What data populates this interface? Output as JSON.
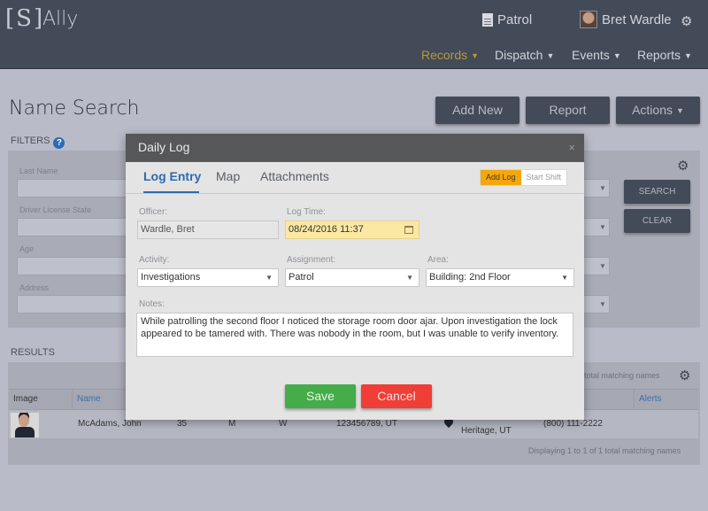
{
  "app": {
    "logo": "[S]",
    "name": "Ally"
  },
  "header": {
    "shift_label": "Patrol",
    "shift_icon": "document-icon",
    "user_name": "Bret Wardle",
    "settings_icon": "gear-icon"
  },
  "nav": [
    {
      "label": "Records",
      "active": true
    },
    {
      "label": "Dispatch",
      "active": false
    },
    {
      "label": "Events",
      "active": false
    },
    {
      "label": "Reports",
      "active": false
    }
  ],
  "page": {
    "title": "Name Search",
    "buttons": {
      "add_new": "Add New",
      "report": "Report",
      "actions": "Actions"
    }
  },
  "filters": {
    "label": "FILTERS",
    "fields": [
      {
        "label": "Last Name",
        "value": ""
      },
      {
        "label": "Driver License State",
        "value": ""
      },
      {
        "label": "Age",
        "value": ""
      },
      {
        "label": "Address",
        "value": ""
      }
    ],
    "search_label": "SEARCH",
    "clear_label": "CLEAR"
  },
  "results": {
    "label": "RESULTS",
    "count_top": "total matching names",
    "columns": [
      "Image",
      "Name",
      "Alerts"
    ],
    "rows": [
      {
        "name": "McAdams, John",
        "age": "35",
        "sex": "M",
        "race": "W",
        "license": "123456789, UT",
        "address_line2": "Heritage, UT",
        "phone": "(800) 111-2222"
      }
    ],
    "count_bottom": "Displaying 1 to 1 of 1 total matching names"
  },
  "modal": {
    "title": "Daily Log",
    "close": "×",
    "tabs": [
      {
        "label": "Log Entry",
        "active": true
      },
      {
        "label": "Map",
        "active": false
      },
      {
        "label": "Attachments",
        "active": false
      }
    ],
    "segment": {
      "add_log": "Add Log",
      "start_shift": "Start Shift",
      "selected": "Add Log"
    },
    "officer": {
      "label": "Officer:",
      "value": "Wardle, Bret"
    },
    "log_time": {
      "label": "Log Time:",
      "value": "08/24/2016 11:37"
    },
    "activity": {
      "label": "Activity:",
      "value": "Investigations"
    },
    "assignment": {
      "label": "Assignment:",
      "value": "Patrol"
    },
    "area": {
      "label": "Area:",
      "value": "Building: 2nd Floor"
    },
    "notes": {
      "label": "Notes:",
      "value": "While patrolling the second floor I noticed the storage room door ajar. Upon investigation the lock appeared to be tamered with. There was nobody in the room, but I was unable to verify inventory."
    },
    "save_label": "Save",
    "cancel_label": "Cancel"
  },
  "colors": {
    "topbar": "#434a58",
    "nav_active": "#b79a37",
    "accent_blue": "#2f6aad",
    "save_green": "#44ad49",
    "cancel_red": "#ef3e36",
    "segment_orange": "#f2a70e"
  }
}
